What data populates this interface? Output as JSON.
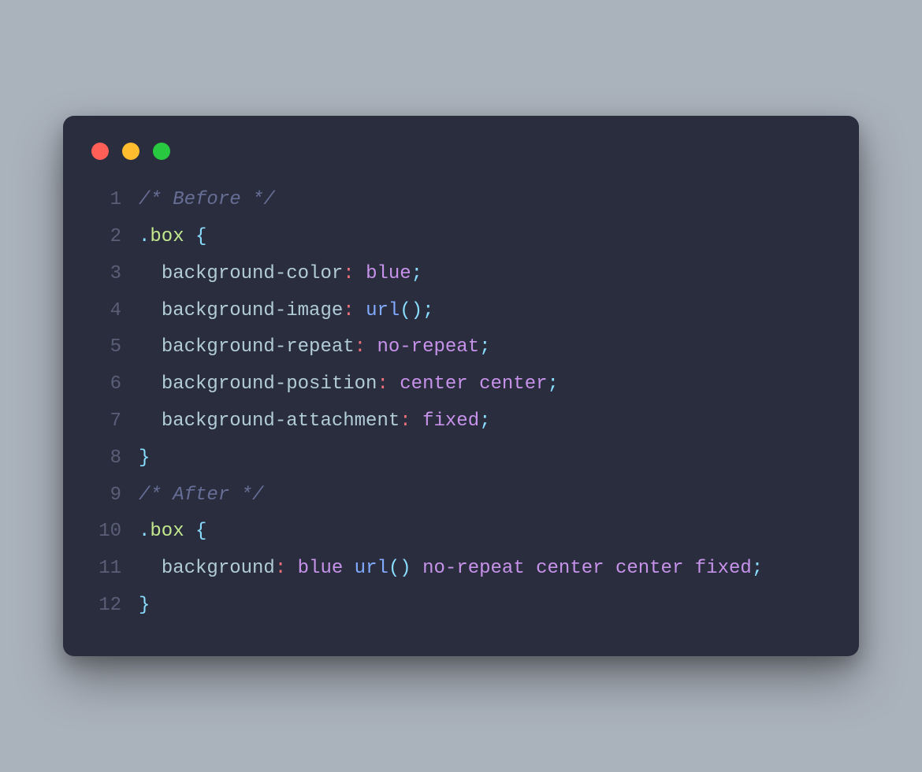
{
  "colors": {
    "bg_page": "#aab2bc",
    "bg_editor": "#292d3e",
    "traffic_red": "#ff5f57",
    "traffic_yellow": "#febc2e",
    "traffic_green": "#28c840",
    "gutter": "#5a5f78",
    "text": "#a6accd",
    "comment": "#676e95",
    "selector": "#c3e88d",
    "brace": "#89ddff",
    "property": "#b2ccd6",
    "colon": "#f07178",
    "value": "#c792ea",
    "func": "#82aaff"
  },
  "code": {
    "lines": [
      {
        "num": "1",
        "indent": 0,
        "tokens": [
          {
            "t": "comment",
            "v": "/* Before */"
          }
        ]
      },
      {
        "num": "2",
        "indent": 0,
        "tokens": [
          {
            "t": "dot",
            "v": "."
          },
          {
            "t": "sel",
            "v": "box"
          },
          {
            "t": "plain",
            "v": " "
          },
          {
            "t": "brace",
            "v": "{"
          }
        ]
      },
      {
        "num": "3",
        "indent": 1,
        "tokens": [
          {
            "t": "prop",
            "v": "background-color"
          },
          {
            "t": "colon",
            "v": ":"
          },
          {
            "t": "plain",
            "v": " "
          },
          {
            "t": "value",
            "v": "blue"
          },
          {
            "t": "semi",
            "v": ";"
          }
        ]
      },
      {
        "num": "4",
        "indent": 1,
        "tokens": [
          {
            "t": "prop",
            "v": "background-image"
          },
          {
            "t": "colon",
            "v": ":"
          },
          {
            "t": "plain",
            "v": " "
          },
          {
            "t": "func",
            "v": "url"
          },
          {
            "t": "paren",
            "v": "("
          },
          {
            "t": "paren",
            "v": ")"
          },
          {
            "t": "semi",
            "v": ";"
          }
        ]
      },
      {
        "num": "5",
        "indent": 1,
        "tokens": [
          {
            "t": "prop",
            "v": "background-repeat"
          },
          {
            "t": "colon",
            "v": ":"
          },
          {
            "t": "plain",
            "v": " "
          },
          {
            "t": "value",
            "v": "no-repeat"
          },
          {
            "t": "semi",
            "v": ";"
          }
        ]
      },
      {
        "num": "6",
        "indent": 1,
        "tokens": [
          {
            "t": "prop",
            "v": "background-position"
          },
          {
            "t": "colon",
            "v": ":"
          },
          {
            "t": "plain",
            "v": " "
          },
          {
            "t": "value",
            "v": "center center"
          },
          {
            "t": "semi",
            "v": ";"
          }
        ]
      },
      {
        "num": "7",
        "indent": 1,
        "tokens": [
          {
            "t": "prop",
            "v": "background-attachment"
          },
          {
            "t": "colon",
            "v": ":"
          },
          {
            "t": "plain",
            "v": " "
          },
          {
            "t": "value",
            "v": "fixed"
          },
          {
            "t": "semi",
            "v": ";"
          }
        ]
      },
      {
        "num": "8",
        "indent": 0,
        "tokens": [
          {
            "t": "brace",
            "v": "}"
          }
        ]
      },
      {
        "num": "9",
        "indent": 0,
        "tokens": [
          {
            "t": "comment",
            "v": "/* After */"
          }
        ]
      },
      {
        "num": "10",
        "indent": 0,
        "tokens": [
          {
            "t": "dot",
            "v": "."
          },
          {
            "t": "sel",
            "v": "box"
          },
          {
            "t": "plain",
            "v": " "
          },
          {
            "t": "brace",
            "v": "{"
          }
        ]
      },
      {
        "num": "11",
        "indent": 1,
        "tokens": [
          {
            "t": "prop",
            "v": "background"
          },
          {
            "t": "colon",
            "v": ":"
          },
          {
            "t": "plain",
            "v": " "
          },
          {
            "t": "value",
            "v": "blue "
          },
          {
            "t": "func",
            "v": "url"
          },
          {
            "t": "paren",
            "v": "("
          },
          {
            "t": "paren",
            "v": ")"
          },
          {
            "t": "value",
            "v": " no-repeat center center fixed"
          },
          {
            "t": "semi",
            "v": ";"
          }
        ]
      },
      {
        "num": "12",
        "indent": 0,
        "tokens": [
          {
            "t": "brace",
            "v": "}"
          }
        ]
      }
    ]
  }
}
